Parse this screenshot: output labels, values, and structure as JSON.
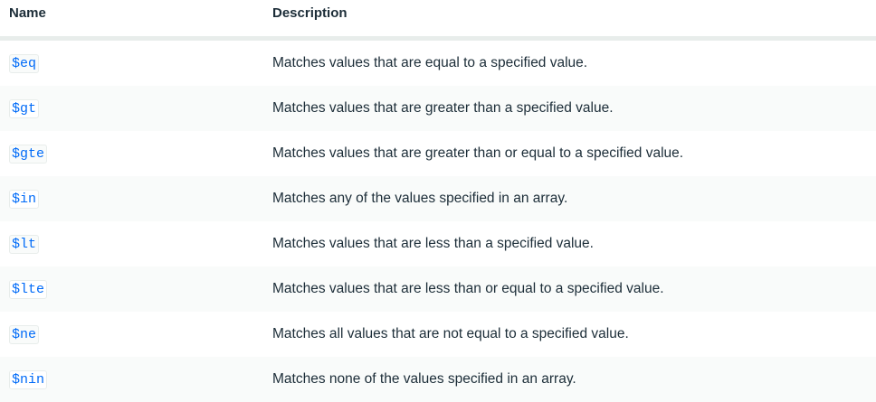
{
  "table": {
    "headers": {
      "name": "Name",
      "description": "Description"
    },
    "rows": [
      {
        "name": "$eq",
        "description": "Matches values that are equal to a specified value."
      },
      {
        "name": "$gt",
        "description": "Matches values that are greater than a specified value."
      },
      {
        "name": "$gte",
        "description": "Matches values that are greater than or equal to a specified value."
      },
      {
        "name": "$in",
        "description": "Matches any of the values specified in an array."
      },
      {
        "name": "$lt",
        "description": "Matches values that are less than a specified value."
      },
      {
        "name": "$lte",
        "description": "Matches values that are less than or equal to a specified value."
      },
      {
        "name": "$ne",
        "description": "Matches all values that are not equal to a specified value."
      },
      {
        "name": "$nin",
        "description": "Matches none of the values specified in an array."
      }
    ]
  },
  "colors": {
    "link": "#016bf8",
    "text": "#1c2d38",
    "row_alt_bg": "#f9fbfa",
    "header_rule": "#e8edeb"
  }
}
